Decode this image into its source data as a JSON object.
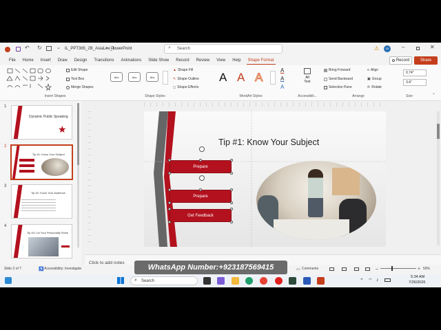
{
  "titlebar": {
    "filename": "IL_PPT365_2B_AsiaLee_1",
    "sep": "•",
    "app": "PowerPoint",
    "search_placeholder": "Search",
    "avatar_initials": "JD"
  },
  "menu": [
    "File",
    "Home",
    "Insert",
    "Draw",
    "Design",
    "Transitions",
    "Animations",
    "Slide Show",
    "Record",
    "Review",
    "View",
    "Help",
    "Shape Format"
  ],
  "record_label": "Record",
  "share_label": "Share",
  "ribbon": {
    "insert_shapes_label": "Insert Shapes",
    "edit_shape": "Edit Shape",
    "text_box": "Text Box",
    "merge_shapes": "Merge Shapes",
    "abc": "Abc",
    "shape_fill": "Shape Fill",
    "shape_outline": "Shape Outline",
    "shape_effects": "Shape Effects",
    "shape_styles_label": "Shape Styles",
    "wordart_glyph": "A",
    "wordart_label": "WordArt Styles",
    "alt_text_1": "Alt",
    "alt_text_2": "Text",
    "accessibility_label": "Accessibili...",
    "bring_forward": "Bring Forward",
    "send_backward": "Send Backward",
    "selection_pane": "Selection Pane",
    "align": "Align",
    "group": "Group",
    "rotate": "Rotate",
    "arrange_label": "Arrange",
    "height": "0.74\"",
    "width": "3.4\"",
    "size_label": "Size"
  },
  "thumbnails": [
    {
      "num": "1",
      "title": "Dynamic Public Speaking"
    },
    {
      "num": "2",
      "title": "Tip #1: Know Your Subject"
    },
    {
      "num": "3",
      "title": "Tip #2: Know Your Audience"
    },
    {
      "num": "4",
      "title": "Tip #3: Let Your Personality Shine"
    }
  ],
  "slide": {
    "title": "Tip #1: Know Your Subject",
    "buttons": [
      "Prepare",
      "Prepare",
      "Get Feedback"
    ]
  },
  "notes_placeholder": "Click to add notes",
  "status": {
    "slide_of": "Slide 2 of 7",
    "accessibility": "Accessibility: Investigate",
    "comments": "Comments",
    "zoom": "59%"
  },
  "taskbar": {
    "search": "Search",
    "time": "5:34 AM",
    "date": "7/26/2026"
  },
  "banner": "WhatsApp Number:+923187569415",
  "colors": {
    "accent": "#c43e1c",
    "slide_red": "#b3111e"
  }
}
